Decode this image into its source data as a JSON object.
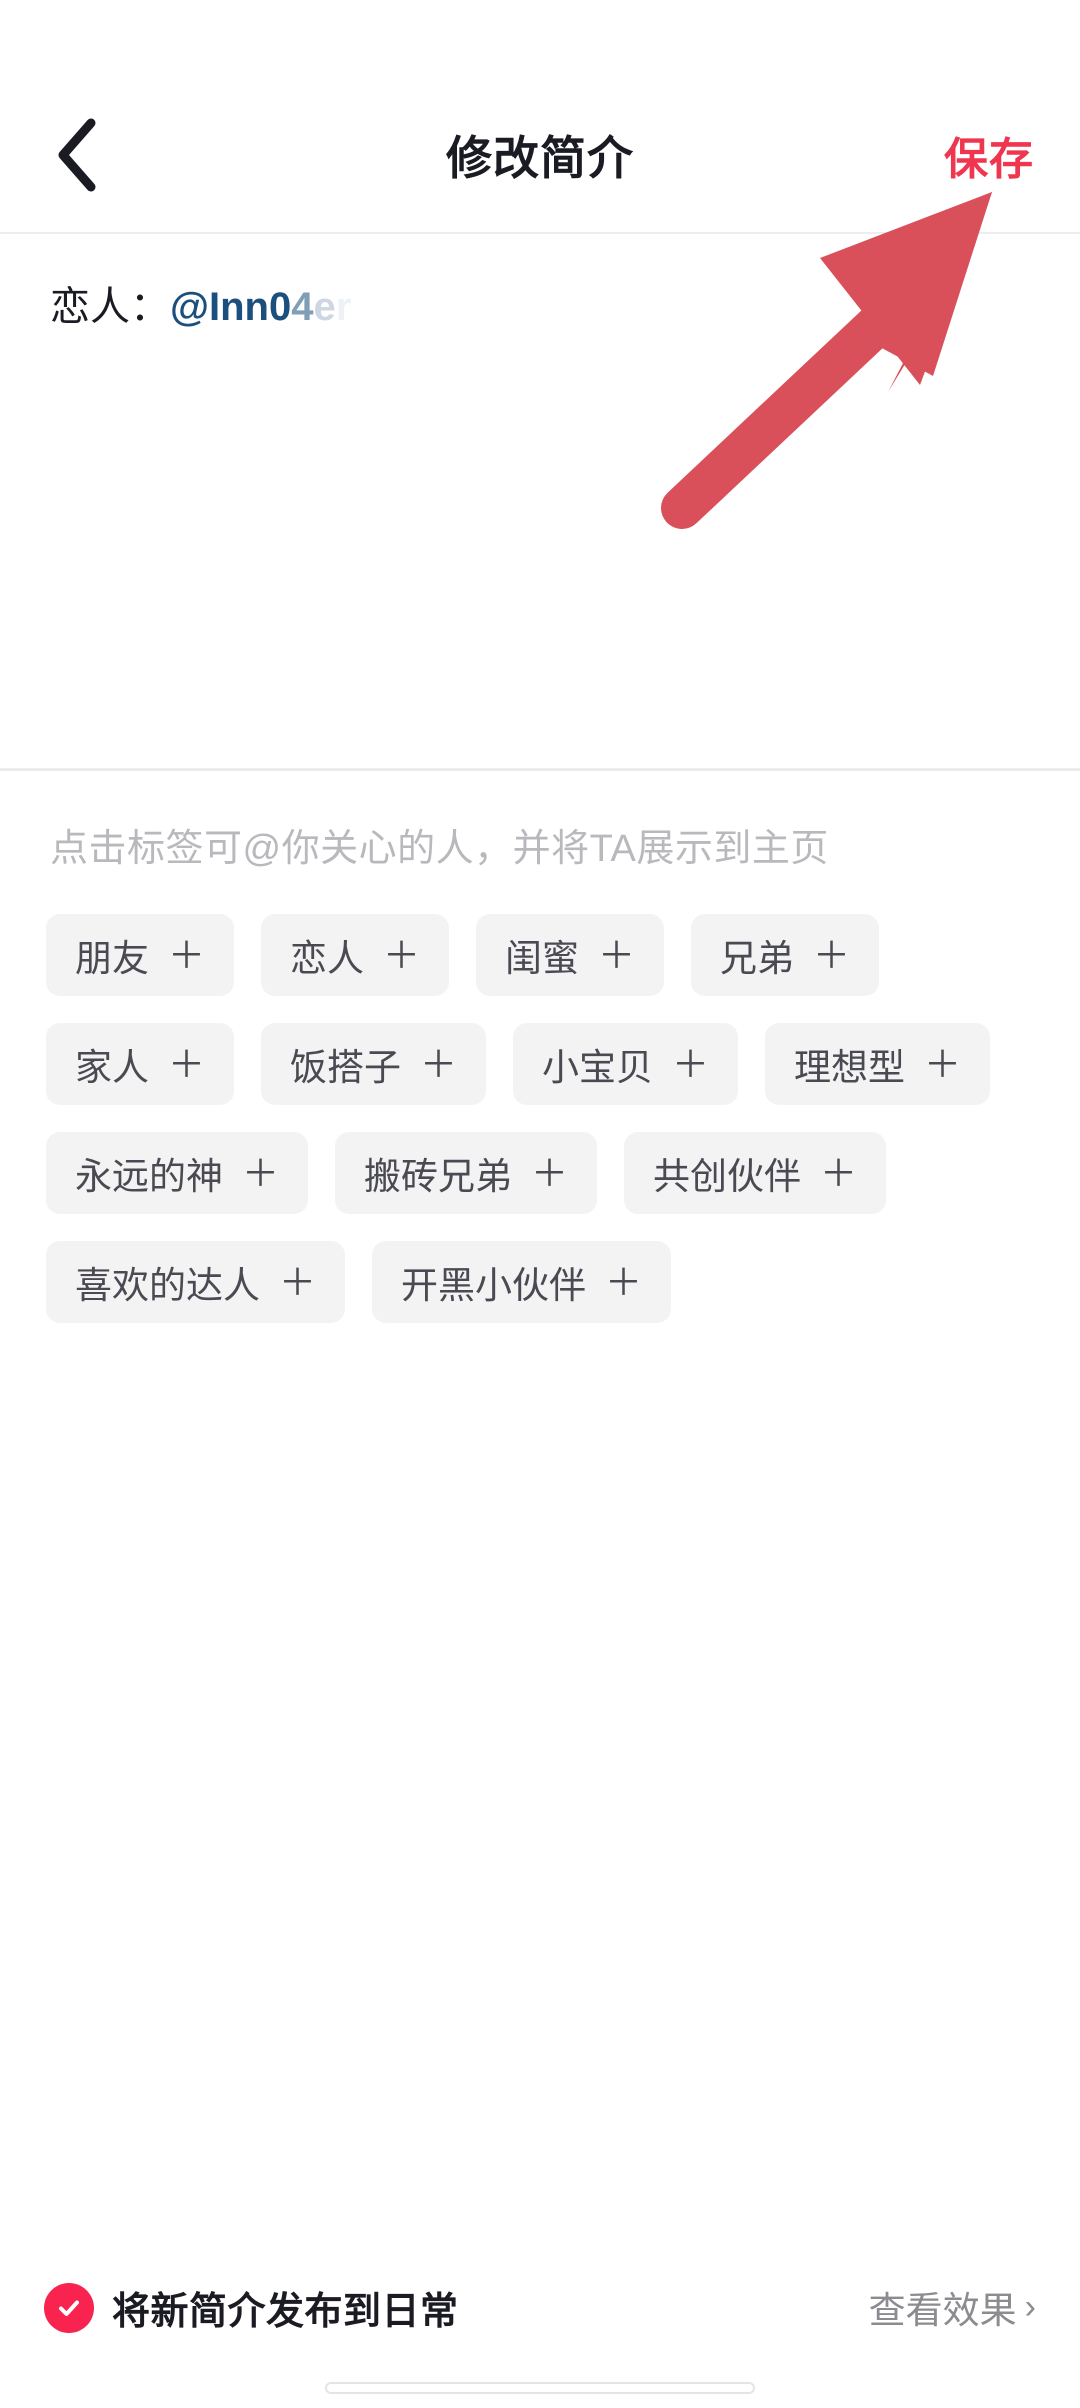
{
  "header": {
    "back_icon": "chevron-left-icon",
    "title": "修改简介",
    "save_label": "保存",
    "save_color": "#f0354f"
  },
  "bio": {
    "label": "恋人：",
    "mention_visible": "@Inn0",
    "mention_fade1": "4",
    "mention_fade2": "e",
    "mention_fade3": "r"
  },
  "tags": {
    "hint": "点击标签可@你关心的人，并将TA展示到主页",
    "plus_glyph": "＋",
    "rows": [
      [
        {
          "label": "朋友"
        },
        {
          "label": "恋人"
        },
        {
          "label": "闺蜜"
        },
        {
          "label": "兄弟"
        }
      ],
      [
        {
          "label": "家人"
        },
        {
          "label": "饭搭子"
        },
        {
          "label": "小宝贝"
        },
        {
          "label": "理想型"
        }
      ],
      [
        {
          "label": "永远的神"
        },
        {
          "label": "搬砖兄弟"
        },
        {
          "label": "共创伙伴"
        }
      ],
      [
        {
          "label": "喜欢的达人"
        },
        {
          "label": "开黑小伙伴"
        }
      ]
    ]
  },
  "bottom": {
    "checkbox_icon": "check-circle-filled-icon",
    "checkbox_checked": true,
    "publish_label": "将新简介发布到日常",
    "preview_label": "查看效果",
    "preview_chevron": "›",
    "accent_color": "#f8234e"
  },
  "annotation": {
    "arrow_color": "#d9505a",
    "arrow_points_to": "save-button"
  }
}
